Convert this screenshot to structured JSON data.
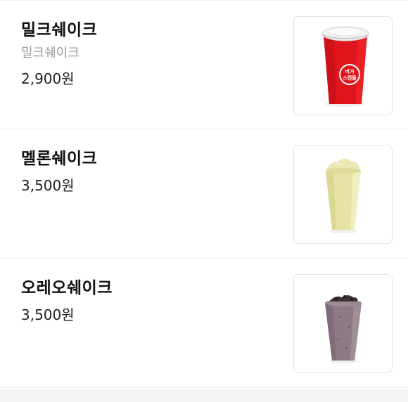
{
  "menu": {
    "items": [
      {
        "name": "밀크쉐이크",
        "description": "밀크쉐이크",
        "price": "2,900원",
        "image_icon": "red-cup-milkshake-icon",
        "cup_logo_line1": "버거",
        "cup_logo_line2": "스캔들"
      },
      {
        "name": "멜론쉐이크",
        "price": "3,500원",
        "image_icon": "melon-shake-icon"
      },
      {
        "name": "오레오쉐이크",
        "price": "3,500원",
        "image_icon": "oreo-shake-icon"
      }
    ]
  },
  "colors": {
    "cup_red": "#e0141c",
    "melon": "#e6e3a6",
    "oreo": "#8d7a86"
  }
}
